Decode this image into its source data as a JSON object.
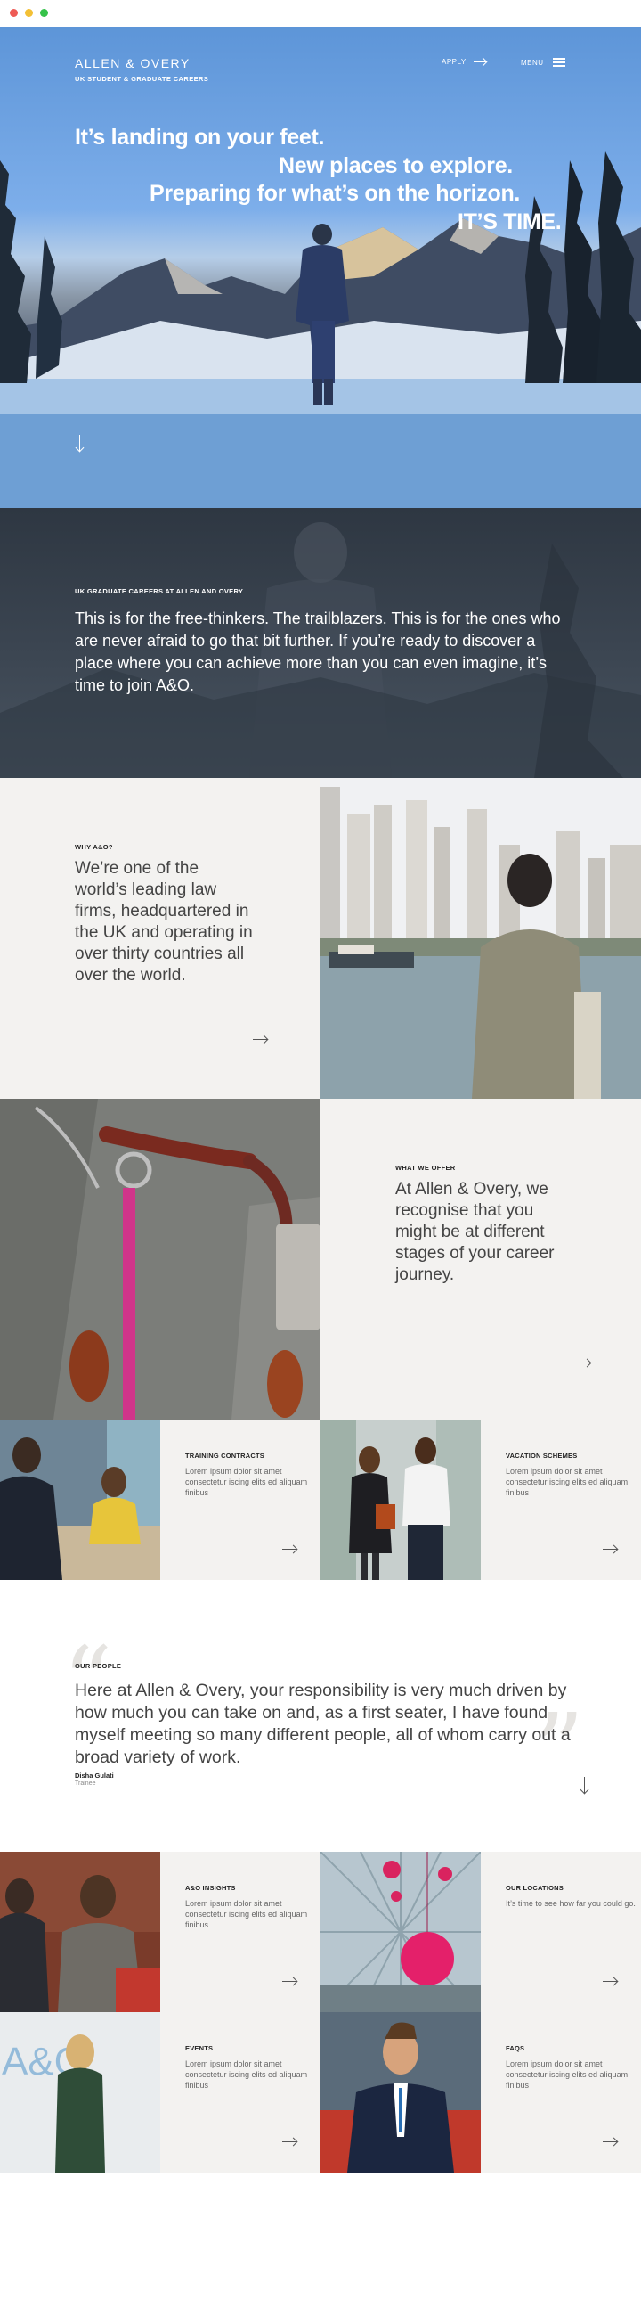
{
  "brand": {
    "name": "ALLEN & OVERY",
    "subtitle": "UK STUDENT & GRADUATE CAREERS"
  },
  "nav": {
    "apply_label": "APPLY",
    "menu_label": "MENU"
  },
  "hero": {
    "lines": [
      "It’s landing on your feet.",
      "New places to explore.",
      "Preparing for what’s on the horizon.",
      "IT’S TIME."
    ]
  },
  "intro": {
    "eyebrow": "UK GRADUATE CAREERS AT ALLEN AND OVERY",
    "text": "This is for the free-thinkers. The trailblazers. This is for the ones who are never afraid to go that bit further. If you’re ready to discover a place where you can achieve more than you can even imagine, it’s time to join A&O."
  },
  "why": {
    "eyebrow": "WHY A&O?",
    "text": "We’re one of the world’s leading law firms, headquartered in the UK and operating in over thirty countries all over the world."
  },
  "offer": {
    "eyebrow": "WHAT WE OFFER",
    "text": "At Allen & Overy, we recognise that you might be at different stages of your career journey."
  },
  "cards_row1": [
    {
      "title": "TRAINING CONTRACTS",
      "body": "Lorem ipsum dolor sit amet consectetur iscing elits ed aliquam finibus"
    },
    {
      "title": "VACATION SCHEMES",
      "body": "Lorem ipsum dolor sit amet consectetur iscing elits ed aliquam finibus"
    }
  ],
  "people": {
    "eyebrow": "OUR PEOPLE",
    "quote": "Here at Allen & Overy, your responsibility is very much driven by how much you can take on and, as a first seater, I have found myself meeting so many different people, all of whom carry out a broad variety of work.",
    "name": "Disha Gulati",
    "role": "Trainee"
  },
  "cards_row2": [
    {
      "title": "A&O INSIGHTS",
      "body": "Lorem ipsum dolor sit amet consectetur iscing elits ed aliquam finibus"
    },
    {
      "title": "OUR LOCATIONS",
      "body": "It’s time to see how far you could go."
    }
  ],
  "cards_row3": [
    {
      "title": "EVENTS",
      "body": "Lorem ipsum dolor sit amet consectetur iscing elits ed aliquam finibus"
    },
    {
      "title": "FAQS",
      "body": "Lorem ipsum dolor sit amet consectetur iscing elits ed aliquam finibus"
    }
  ],
  "colors": {
    "hero_sky": "#6fa3e0",
    "dark_panel": "#3a434f",
    "light_panel": "#f3f2f0",
    "quote_mark": "#e6e4e1"
  }
}
